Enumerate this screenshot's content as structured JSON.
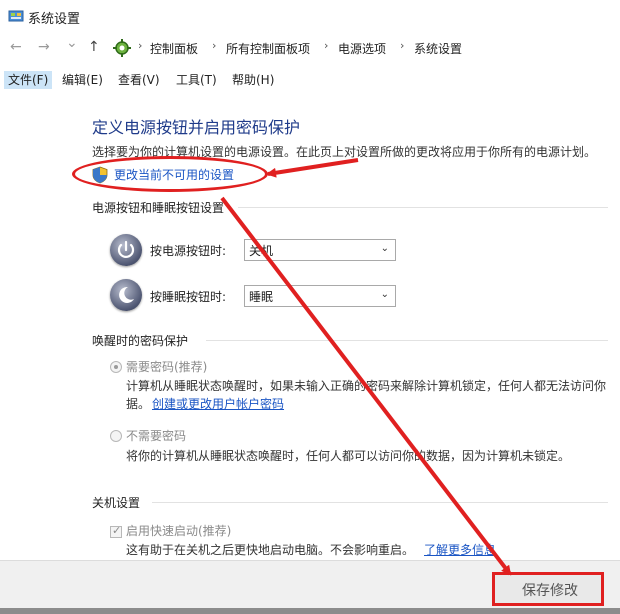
{
  "window": {
    "title": "系统设置"
  },
  "nav": {
    "back": "←",
    "forward": "→",
    "dropdown": "⌄",
    "up": "↑",
    "breadcrumbs": [
      "控制面板",
      "所有控制面板项",
      "电源选项",
      "系统设置"
    ],
    "separator": "›"
  },
  "menu": [
    "文件(F)",
    "编辑(E)",
    "查看(V)",
    "工具(T)",
    "帮助(H)"
  ],
  "main": {
    "heading": "定义电源按钮并启用密码保护",
    "description": "选择要为你的计算机设置的电源设置。在此页上对设置所做的更改将应用于你所有的电源计划。",
    "change_link": "更改当前不可用的设置"
  },
  "power_section": {
    "title": "电源按钮和睡眠按钮设置",
    "power_button_label": "按电源按钮时:",
    "power_button_value": "关机",
    "sleep_button_label": "按睡眠按钮时:",
    "sleep_button_value": "睡眠"
  },
  "wake_section": {
    "title": "唤醒时的密码保护",
    "require_password_label": "需要密码(推荐)",
    "require_password_desc_1": "计算机从睡眠状态唤醒时，如果未输入正确的密码来解除计算机锁定，任何人都无法访问你",
    "require_password_desc_2": "据。",
    "create_password_link": "创建或更改用户帐户密码",
    "no_password_label": "不需要密码",
    "no_password_desc": "将你的计算机从睡眠状态唤醒时，任何人都可以访问你的数据，因为计算机未锁定。"
  },
  "shutdown_section": {
    "title": "关机设置",
    "fast_startup_label": "启用快速启动(推荐)",
    "fast_startup_desc": "这有助于在关机之后更快地启动电脑。不会影响重启。",
    "learn_more_link": "了解更多信息"
  },
  "footer": {
    "save_label": "保存修改"
  },
  "arrow_down": "⌄",
  "colors": {
    "annotation_red": "#e02020",
    "link_blue": "#1a55c4",
    "heading_blue": "#1f3b8a"
  }
}
